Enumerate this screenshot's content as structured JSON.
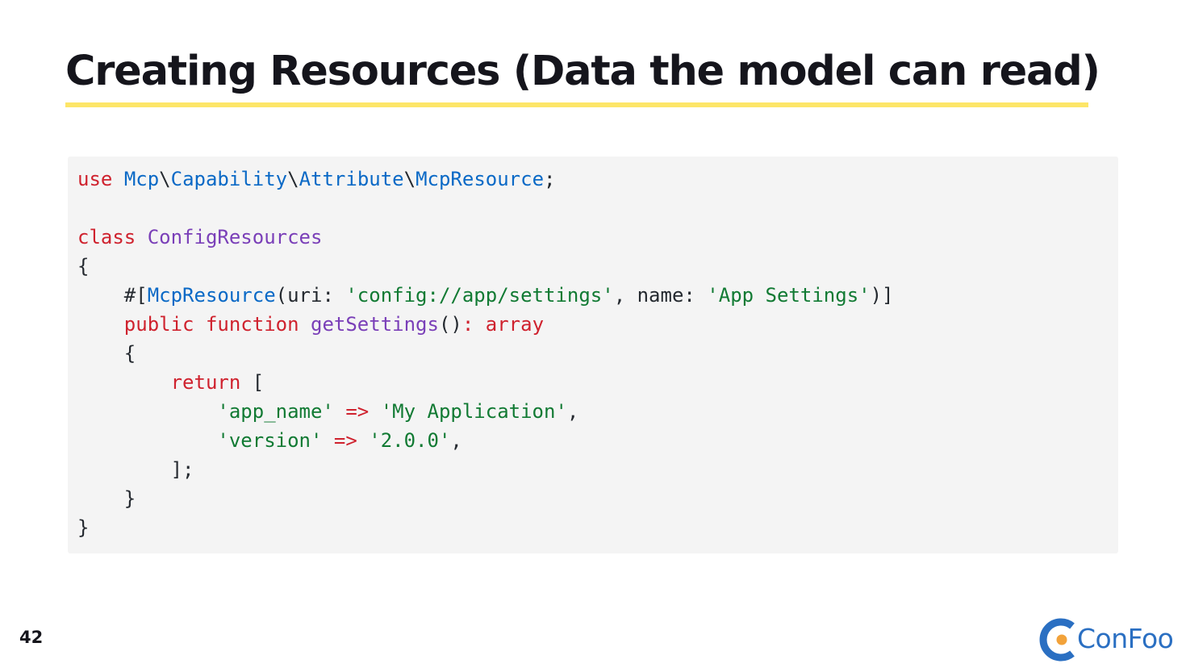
{
  "slide": {
    "title": "Creating Resources (Data the model can read)",
    "page_number": "42"
  },
  "brand": {
    "name": "ConFoo",
    "logo_icon": "confoo-c-logo-icon",
    "colors": {
      "blue": "#2a6fc2",
      "orange": "#f2a23a"
    }
  },
  "colors": {
    "underline": "#fde568",
    "code_background": "#f4f4f4",
    "keyword": "#cf222e",
    "namespace": "#0a69c6",
    "class_name": "#7a3fb8",
    "string": "#117a33",
    "text": "#24292f"
  },
  "code": {
    "language": "php",
    "lines": [
      [
        {
          "t": "kw",
          "v": "use"
        },
        {
          "t": "plain",
          "v": " "
        },
        {
          "t": "ns",
          "v": "Mcp"
        },
        {
          "t": "plain",
          "v": "\\"
        },
        {
          "t": "ns",
          "v": "Capability"
        },
        {
          "t": "plain",
          "v": "\\"
        },
        {
          "t": "ns",
          "v": "Attribute"
        },
        {
          "t": "plain",
          "v": "\\"
        },
        {
          "t": "ns",
          "v": "McpResource"
        },
        {
          "t": "plain",
          "v": ";"
        }
      ],
      [],
      [
        {
          "t": "kw",
          "v": "class"
        },
        {
          "t": "plain",
          "v": " "
        },
        {
          "t": "cls",
          "v": "ConfigResources"
        }
      ],
      [
        {
          "t": "plain",
          "v": "{"
        }
      ],
      [
        {
          "t": "plain",
          "v": "    #["
        },
        {
          "t": "ns",
          "v": "McpResource"
        },
        {
          "t": "plain",
          "v": "(uri: "
        },
        {
          "t": "str",
          "v": "'config://app/settings'"
        },
        {
          "t": "plain",
          "v": ", name: "
        },
        {
          "t": "str",
          "v": "'App Settings'"
        },
        {
          "t": "plain",
          "v": ")]"
        }
      ],
      [
        {
          "t": "plain",
          "v": "    "
        },
        {
          "t": "kw",
          "v": "public"
        },
        {
          "t": "plain",
          "v": " "
        },
        {
          "t": "kw",
          "v": "function"
        },
        {
          "t": "plain",
          "v": " "
        },
        {
          "t": "fn",
          "v": "getSettings"
        },
        {
          "t": "plain",
          "v": "()"
        },
        {
          "t": "op",
          "v": ":"
        },
        {
          "t": "plain",
          "v": " "
        },
        {
          "t": "kw",
          "v": "array"
        }
      ],
      [
        {
          "t": "plain",
          "v": "    {"
        }
      ],
      [
        {
          "t": "plain",
          "v": "        "
        },
        {
          "t": "kw",
          "v": "return"
        },
        {
          "t": "plain",
          "v": " ["
        }
      ],
      [
        {
          "t": "plain",
          "v": "            "
        },
        {
          "t": "str",
          "v": "'app_name'"
        },
        {
          "t": "plain",
          "v": " "
        },
        {
          "t": "op",
          "v": "=>"
        },
        {
          "t": "plain",
          "v": " "
        },
        {
          "t": "str",
          "v": "'My Application'"
        },
        {
          "t": "plain",
          "v": ","
        }
      ],
      [
        {
          "t": "plain",
          "v": "            "
        },
        {
          "t": "str",
          "v": "'version'"
        },
        {
          "t": "plain",
          "v": " "
        },
        {
          "t": "op",
          "v": "=>"
        },
        {
          "t": "plain",
          "v": " "
        },
        {
          "t": "str",
          "v": "'2.0.0'"
        },
        {
          "t": "plain",
          "v": ","
        }
      ],
      [
        {
          "t": "plain",
          "v": "        ];"
        }
      ],
      [
        {
          "t": "plain",
          "v": "    }"
        }
      ],
      [
        {
          "t": "plain",
          "v": "}"
        }
      ]
    ]
  }
}
